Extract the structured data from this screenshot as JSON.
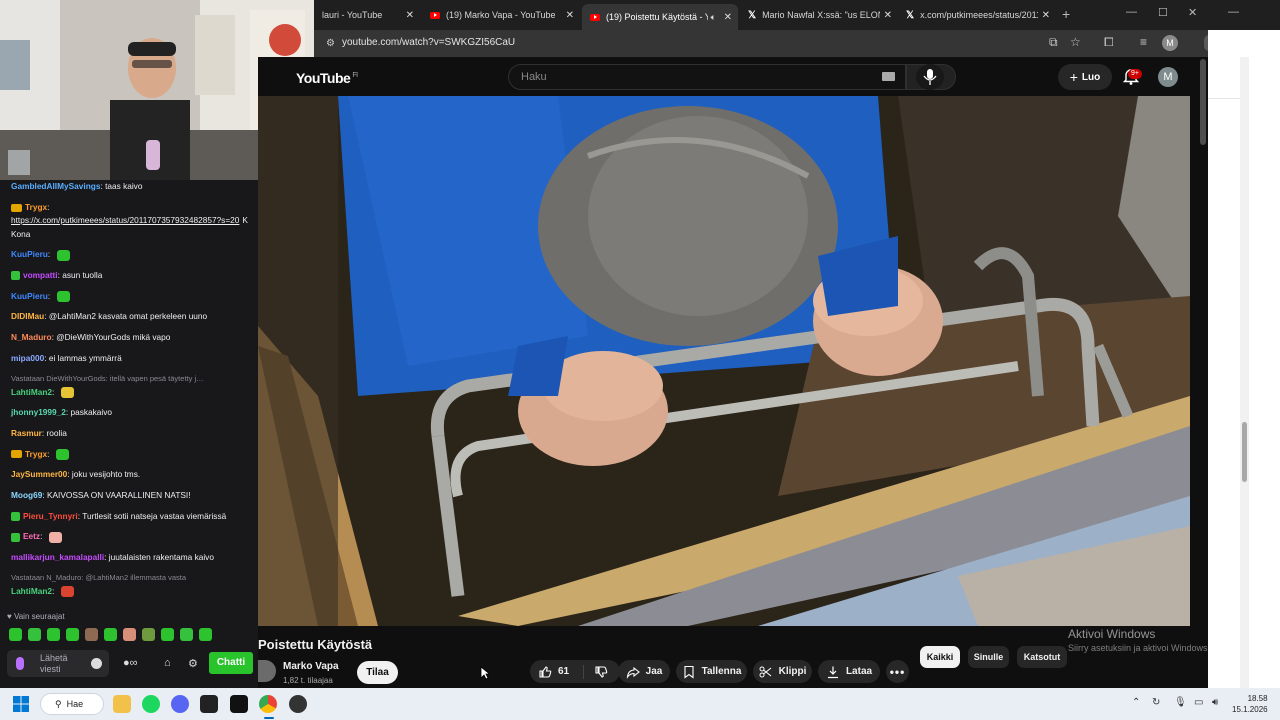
{
  "browser": {
    "tabs": [
      {
        "title": "lauri - YouTube",
        "icon": "youtube-icon"
      },
      {
        "title": "(19) Marko Vapa - YouTube",
        "icon": "youtube-icon"
      },
      {
        "title": "(19) Poistettu Käytöstä - Yo",
        "icon": "youtube-icon",
        "active": true
      },
      {
        "title": "Mario Nawfal X:ssä: \"us ELON J",
        "icon": "x-icon"
      },
      {
        "title": "x.com/putkimeees/status/2011",
        "icon": "x-icon"
      }
    ],
    "url": "youtube.com/watch?v=SWKGZI56CaU",
    "profile_initial": "M"
  },
  "youtube": {
    "logo": "YouTube",
    "region": "FI",
    "search_placeholder": "Haku",
    "create_label": "Luo",
    "notification_count": "9+",
    "avatar_initial": "M",
    "video_title": "Poistettu Käytöstä",
    "channel_name": "Marko Vapa",
    "subscribers": "1,82 t. tilaajaa",
    "subscribe_label": "Tilaa",
    "likes": "61",
    "actions": {
      "share": "Jaa",
      "save": "Tallenna",
      "clip": "Klippi",
      "download": "Lataa"
    },
    "filters": [
      "Kaikki",
      "Sinulle",
      "Katsotut"
    ]
  },
  "watermark": {
    "title": "Aktivoi Windows",
    "subtitle": "Siirry asetuksiin ja aktivoi Windows."
  },
  "chat": {
    "messages": [
      {
        "user": "GambledAllMySavings",
        "color": "#5aafff",
        "text": "taas kaivo"
      },
      {
        "user": "Trygx",
        "color": "#ff9e2c",
        "badge": "crown",
        "text": "",
        "link": "https://x.com/putkimeees/status/2011707357932482857?s=20",
        "after": "KKona"
      },
      {
        "user": "KuuPieru",
        "color": "#3f88ff",
        "emote": "#2cc32f",
        "text": ""
      },
      {
        "user": "vompatti",
        "color": "#c54bff",
        "badge": "green",
        "text": "asun tuolla"
      },
      {
        "user": "KuuPieru",
        "color": "#3f88ff",
        "emote": "#2cc32f",
        "text": ""
      },
      {
        "user": "DIDIMau",
        "color": "#ffb640",
        "text": "@LahtiMan2 kasvata omat perkeleen uuno"
      },
      {
        "user": "N_Maduro",
        "color": "#ff8a5a",
        "text": "@DieWithYourGods mikä vapo"
      },
      {
        "user": "mipa000",
        "color": "#8aa8ff",
        "text": "ei lammas ymmärrä"
      },
      {
        "reply": "Vastataan DieWithYourGods: itellä vapen pesä täytetty j…",
        "user": "LahtiMan2",
        "color": "#46d17c",
        "emote": "#e5c536",
        "text": ""
      },
      {
        "user": "jhonny1999_2",
        "color": "#59d8ad",
        "text": "paskakaivo"
      },
      {
        "user": "Rasmur",
        "color": "#ffb640",
        "text": "roolia"
      },
      {
        "user": "Trygx",
        "color": "#ff9e2c",
        "badge": "crown",
        "emote": "#2cc32f",
        "text": ""
      },
      {
        "user": "JaySummer00",
        "color": "#ffb640",
        "text": "joku vesijohto tms."
      },
      {
        "user": "Moog69",
        "color": "#8ad8ff",
        "text": "KAIVOSSA ON VAARALLINEN NATSI!"
      },
      {
        "user": "Pieru_Tynnyri",
        "color": "#ff4d3d",
        "badge": "green",
        "text": "Turtlesit sotii natseja vastaa viemärissä"
      },
      {
        "user": "Eetz",
        "color": "#ff6bb5",
        "badge": "green",
        "emote": "#f0b0a8",
        "text": ""
      },
      {
        "user": "mallikarjun_kamalapalli",
        "color": "#c54bff",
        "text": "juutalaisten rakentama kaivo"
      },
      {
        "reply": "Vastataan N_Maduro: @LahtiMan2 illemmasta vasta",
        "user": "LahtiMan2",
        "color": "#46d17c",
        "emote": "#d9432f",
        "text": ""
      }
    ],
    "followers_only": "Vain seuraajat",
    "input_placeholder": "Lähetä viesti",
    "send_label": "Chatti"
  },
  "taskbar": {
    "search_label": "Hae",
    "time": "18.58",
    "date": "15.1.2026"
  }
}
